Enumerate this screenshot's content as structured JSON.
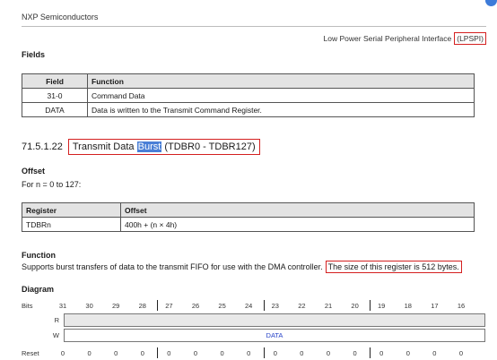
{
  "header": {
    "company": "NXP Semiconductors",
    "chapter_prefix": "Low Power Serial Peripheral Interface",
    "chapter_boxed": "(LPSPI)"
  },
  "fields_heading": "Fields",
  "fields_table": {
    "headers": [
      "Field",
      "Function"
    ],
    "rows": [
      [
        "31-0",
        "Command Data"
      ],
      [
        "DATA",
        "Data is written to the Transmit Command Register."
      ]
    ]
  },
  "section": {
    "number": "71.5.1.22",
    "title_pre": "Transmit Data ",
    "title_highlight": "Burst",
    "title_post": " (TDBR0 - TDBR127)"
  },
  "offset_heading": "Offset",
  "offset_text": "For n = 0 to 127:",
  "offset_table": {
    "headers": [
      "Register",
      "Offset"
    ],
    "rows": [
      [
        "TDBRn",
        "400h + (n × 4h)"
      ]
    ]
  },
  "function_heading": "Function",
  "function_text": "Supports burst transfers of data to the transmit FIFO for use with the DMA controller.",
  "function_boxed": "The size of this register is 512 bytes.",
  "diagram_heading": "Diagram",
  "diagram": {
    "bits_label": "Bits",
    "bit_numbers": [
      "31",
      "30",
      "29",
      "28",
      "27",
      "26",
      "25",
      "24",
      "23",
      "22",
      "21",
      "20",
      "19",
      "18",
      "17",
      "16"
    ],
    "row_r": "R",
    "row_w": "W",
    "field_name": "DATA",
    "reset_label": "Reset",
    "reset_values": [
      "0",
      "0",
      "0",
      "0",
      "0",
      "0",
      "0",
      "0",
      "0",
      "0",
      "0",
      "0",
      "0",
      "0",
      "0",
      "0"
    ]
  },
  "colors": {
    "highlight_box": "#d42020",
    "selection": "#4a7fd6",
    "field_text": "#2a45c8"
  }
}
